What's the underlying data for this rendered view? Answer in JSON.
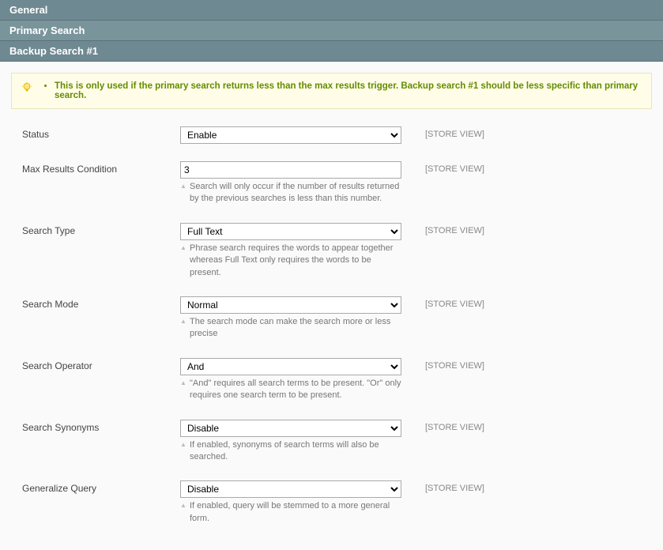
{
  "sections": {
    "general": "General",
    "primary": "Primary Search",
    "backup1": "Backup Search #1"
  },
  "notice": {
    "text": "This is only used if the primary search returns less than the max results trigger. Backup search #1 should be less specific than primary search."
  },
  "scope_label": "[STORE VIEW]",
  "fields": {
    "status": {
      "label": "Status",
      "value": "Enable"
    },
    "max_results": {
      "label": "Max Results Condition",
      "value": "3",
      "help": "Search will only occur if the number of results returned by the previous searches is less than this number."
    },
    "search_type": {
      "label": "Search Type",
      "value": "Full Text",
      "help": "Phrase search requires the words to appear together whereas Full Text only requires the words to be present."
    },
    "search_mode": {
      "label": "Search Mode",
      "value": "Normal",
      "help": "The search mode can make the search more or less precise"
    },
    "search_operator": {
      "label": "Search Operator",
      "value": "And",
      "help": "\"And\" requires all search terms to be present. \"Or\" only requires one search term to be present."
    },
    "search_synonyms": {
      "label": "Search Synonyms",
      "value": "Disable",
      "help": "If enabled, synonyms of search terms will also be searched."
    },
    "generalize_query": {
      "label": "Generalize Query",
      "value": "Disable",
      "help": "If enabled, query will be stemmed to a more general form."
    }
  }
}
